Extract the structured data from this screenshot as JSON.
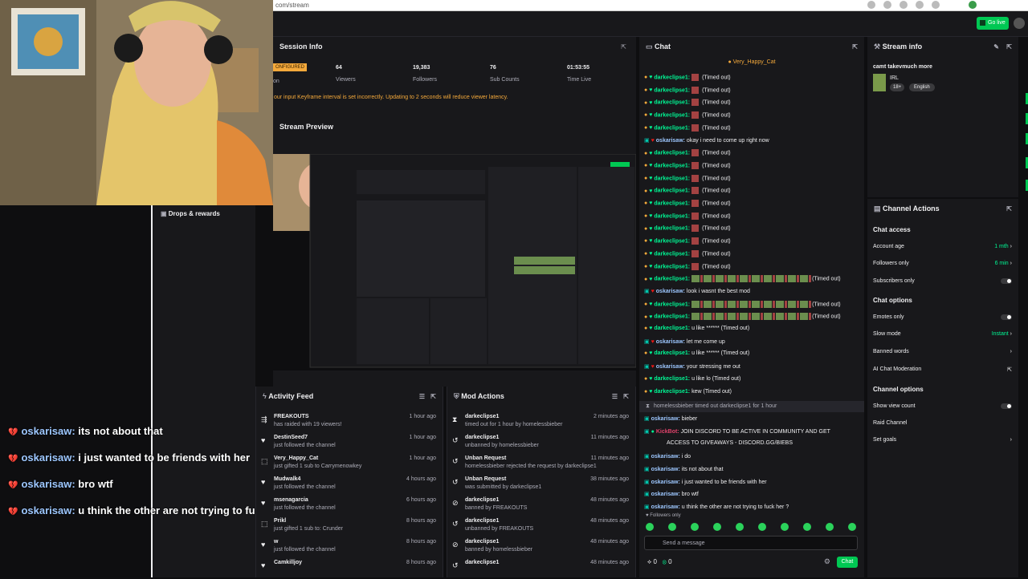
{
  "browser": {
    "url": "com/stream"
  },
  "topnav": {
    "go_live": "Go live"
  },
  "session": {
    "title": "Session Info",
    "badge": "ONFIGURED",
    "badge_sub": "on",
    "stats": [
      {
        "value": "64",
        "label": "Viewers"
      },
      {
        "value": "19,383",
        "label": "Followers"
      },
      {
        "value": "76",
        "label": "Sub Counts"
      },
      {
        "value": "01:53:55",
        "label": "Time Live"
      }
    ],
    "warning": "our input Keyframe interval is set incorrectly. Updating to 2 seconds will reduce viewer latency."
  },
  "preview": {
    "title": "Stream Preview"
  },
  "drops": {
    "title": "Drops & rewards"
  },
  "overlay_chat": [
    {
      "user": "oskarisaw:",
      "text": "its not about that"
    },
    {
      "user": "oskarisaw:",
      "text": "i just wanted to be friends with her"
    },
    {
      "user": "oskarisaw:",
      "text": "bro wtf"
    },
    {
      "user": "oskarisaw:",
      "text": "u think the other are not trying to fuck her ?"
    }
  ],
  "activity": {
    "title": "Activity Feed",
    "items": [
      {
        "name": "FREAKOUTS",
        "sub": "has raided with 19 viewers!",
        "time": "1 hour ago"
      },
      {
        "name": "DestinSeed7",
        "sub": "just followed the channel",
        "time": "1 hour ago"
      },
      {
        "name": "Very_Happy_Cat",
        "sub": "just gifted 1 sub to Carrymenowkey",
        "time": "1 hour ago"
      },
      {
        "name": "Mudwalk4",
        "sub": "just followed the channel",
        "time": "4 hours ago"
      },
      {
        "name": "msenagarcia",
        "sub": "just followed the channel",
        "time": "6 hours ago"
      },
      {
        "name": "Prikl",
        "sub": "just gifted 1 sub to: Crunder",
        "time": "8 hours ago"
      },
      {
        "name": "w",
        "sub": "just followed the channel",
        "time": "8 hours ago"
      },
      {
        "name": "Camkilljoy",
        "sub": "",
        "time": "8 hours ago"
      }
    ]
  },
  "mod": {
    "title": "Mod Actions",
    "items": [
      {
        "name": "darkeclipse1",
        "sub": "timed out for 1 hour by homelessbieber",
        "time": "2 minutes ago"
      },
      {
        "name": "darkeclipse1",
        "sub": "unbanned by homelessbieber",
        "time": "11 minutes ago"
      },
      {
        "name": "Unban Request",
        "sub": "homelessbieber rejected the request by darkeclipse1",
        "time": "11 minutes ago"
      },
      {
        "name": "Unban Request",
        "sub": "was submitted by darkeclipse1",
        "time": "38 minutes ago"
      },
      {
        "name": "darkeclipse1",
        "sub": "banned by FREAKOUTS",
        "time": "48 minutes ago"
      },
      {
        "name": "darkeclipse1",
        "sub": "unbanned by FREAKOUTS",
        "time": "48 minutes ago"
      },
      {
        "name": "darkeclipse1",
        "sub": "banned by homelessbieber",
        "time": "48 minutes ago"
      },
      {
        "name": "darkeclipse1",
        "sub": "",
        "time": "48 minutes ago"
      }
    ]
  },
  "chat": {
    "title": "Chat",
    "pinned": "Very_Happy_Cat",
    "timed_out": "(Timed out)",
    "lines": [
      {
        "user": "darkeclipse1:",
        "text": "(Timed out)",
        "kind": "to"
      },
      {
        "user": "darkeclipse1:",
        "text": "(Timed out)",
        "kind": "to"
      },
      {
        "user": "darkeclipse1:",
        "text": "(Timed out)",
        "kind": "to"
      },
      {
        "user": "darkeclipse1:",
        "text": "(Timed out)",
        "kind": "to"
      },
      {
        "user": "darkeclipse1:",
        "text": "(Timed out)",
        "kind": "to"
      },
      {
        "user": "oskarisaw:",
        "text": "okay i need to come up right now",
        "kind": "o"
      },
      {
        "user": "darkeclipse1:",
        "text": "(Timed out)",
        "kind": "to"
      },
      {
        "user": "darkeclipse1:",
        "text": "(Timed out)",
        "kind": "to"
      },
      {
        "user": "darkeclipse1:",
        "text": "(Timed out)",
        "kind": "to"
      },
      {
        "user": "darkeclipse1:",
        "text": "(Timed out)",
        "kind": "to"
      },
      {
        "user": "darkeclipse1:",
        "text": "(Timed out)",
        "kind": "to"
      },
      {
        "user": "darkeclipse1:",
        "text": "(Timed out)",
        "kind": "to"
      },
      {
        "user": "darkeclipse1:",
        "text": "(Timed out)",
        "kind": "to"
      },
      {
        "user": "darkeclipse1:",
        "text": "(Timed out)",
        "kind": "to"
      },
      {
        "user": "darkeclipse1:",
        "text": "(Timed out)",
        "kind": "to"
      },
      {
        "user": "darkeclipse1:",
        "text": "(Timed out)",
        "kind": "to"
      },
      {
        "user": "darkeclipse1:",
        "text": "(Timed out)",
        "kind": "long"
      },
      {
        "user": "oskarisaw:",
        "text": "look i wasnt the best mod",
        "kind": "o"
      },
      {
        "user": "darkeclipse1:",
        "text": "(Timed out)",
        "kind": "long"
      },
      {
        "user": "darkeclipse1:",
        "text": "(Timed out)",
        "kind": "long"
      },
      {
        "user": "darkeclipse1:",
        "text": "u like ****** (Timed out)",
        "kind": "plain"
      },
      {
        "user": "oskarisaw:",
        "text": "let me come up",
        "kind": "o"
      },
      {
        "user": "darkeclipse1:",
        "text": "u like ****** (Timed out)",
        "kind": "plain"
      },
      {
        "user": "oskarisaw:",
        "text": "your stressing me out",
        "kind": "o"
      },
      {
        "user": "darkeclipse1:",
        "text": "u like lo (Timed out)",
        "kind": "plain"
      },
      {
        "user": "darkeclipse1:",
        "text": "kew (Timed out)",
        "kind": "plain"
      }
    ],
    "notice": "homelessbieber timed out darkeclipse1 for 1 hour",
    "after": [
      {
        "user": "oskarisaw:",
        "text": "bieber"
      },
      {
        "user": "KickBot:",
        "text": "JOIN DISCORD TO BE ACTIVE IN COMMUNITY AND GET"
      },
      {
        "user": "",
        "text": "ACCESS TO GIVEAWAYS - DISCORD.GG/BIEBS"
      },
      {
        "user": "oskarisaw:",
        "text": "i do"
      },
      {
        "user": "oskarisaw:",
        "text": "its not about that"
      },
      {
        "user": "oskarisaw:",
        "text": "i just wanted to be friends with her"
      },
      {
        "user": "oskarisaw:",
        "text": "bro wtf"
      },
      {
        "user": "oskarisaw:",
        "text": "u think the other are not trying to fuck her ?"
      }
    ],
    "followers_only": "Followers only",
    "placeholder": "Send a message",
    "send": "Chat",
    "count_a": "0",
    "count_b": "0"
  },
  "stream_info": {
    "title": "Stream info",
    "stream_title": "camt takevmuch more",
    "category": "IRL",
    "tags": [
      "18+",
      "English"
    ]
  },
  "channel_actions": {
    "title": "Channel Actions",
    "chat_access": "Chat access",
    "account_age": {
      "label": "Account age",
      "value": "1 mth"
    },
    "followers_only": {
      "label": "Followers only",
      "value": "6 min"
    },
    "subscribers_only": "Subscribers only",
    "chat_options": "Chat options",
    "emotes_only": "Emotes only",
    "slow_mode": {
      "label": "Slow mode",
      "value": "Instant"
    },
    "banned_words": "Banned words",
    "ai_mod": "AI Chat Moderation",
    "channel_options": "Channel options",
    "show_viewcount": "Show view count",
    "raid": "Raid Channel",
    "goals": "Set goals"
  },
  "colors": {
    "accent": "#00c853",
    "bg": "#0e0e10",
    "panel": "#18181b",
    "warning": "#f4a93b",
    "heart": "#e91916",
    "username_green": "#00f593"
  }
}
